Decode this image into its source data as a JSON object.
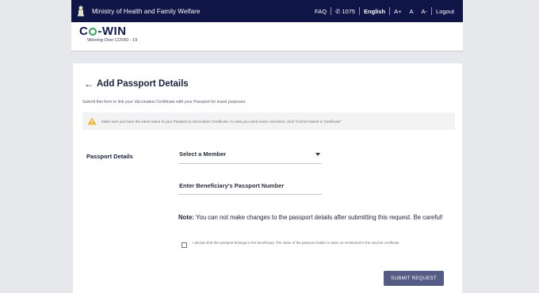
{
  "topbar": {
    "ministry": "Ministry of Health and Family Welfare",
    "faq": "FAQ",
    "helpline": "1075",
    "language": "English",
    "font_increase": "A+",
    "font_normal": "A",
    "font_decrease": "A-",
    "logout": "Logout"
  },
  "header": {
    "logo_c": "C",
    "logo_rest": "-WIN",
    "tagline": "Winning Over COVID - 19"
  },
  "page": {
    "title": "Add Passport Details",
    "subtitle": "Submit this form to link your Vaccination Certificate with your Passport for travel purposes.",
    "notice": "Make sure you have the same name in your Passport & Vaccination Certificate. In case you need name correction, click \"Correct Name in Certificate\"",
    "passport_details_label": "Passport Details",
    "select_member": "Select a Member",
    "passport_placeholder": "Enter Beneficiary's Passport Number",
    "note_prefix": "Note:",
    "note_body": " You can not make changes to the passport details after submitting this request. Be careful!",
    "declaration": "I declare that this passport belongs to the beneficiary. The name of the passport holder is same as mentioned in the vaccine certificate.",
    "submit": "SUBMIT REQUEST"
  },
  "colors": {
    "topbar_bg": "#101547",
    "logo_ring": "#2fa35a",
    "submit_bg": "#545b85",
    "page_bg": "#e6e8ec"
  }
}
